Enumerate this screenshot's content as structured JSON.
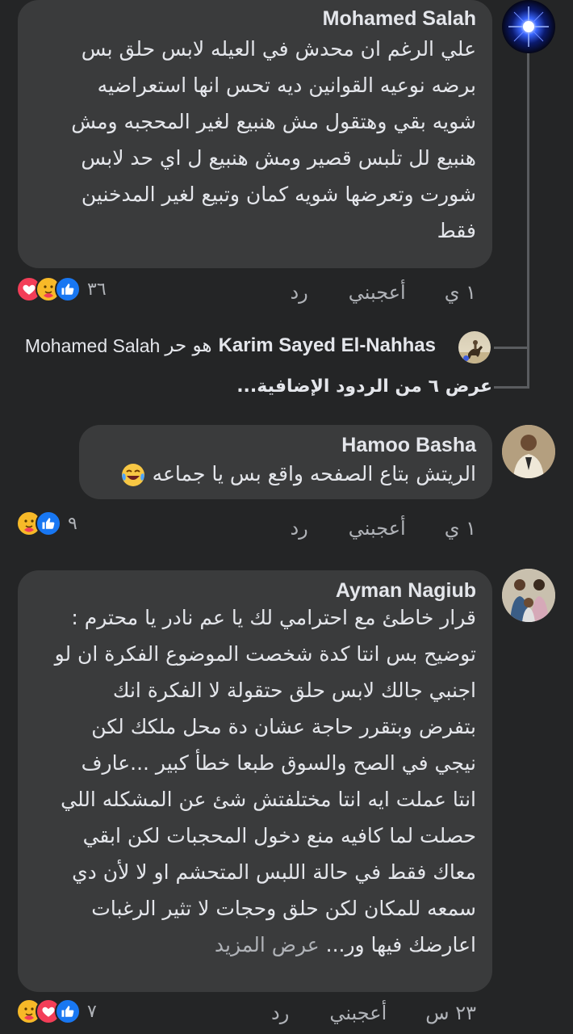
{
  "colors": {
    "background": "#242526",
    "bubble": "#3a3b3c",
    "text_primary": "#e4e6eb",
    "text_secondary": "#b0b3b8",
    "like_blue": "#1877f2",
    "love_red": "#f33e58",
    "care_yellow": "#f7b928"
  },
  "comments": [
    {
      "author": "Mohamed Salah",
      "lines": [
        "علي الرغم ان محدش في العيله لابس حلق بس",
        "برضه نوعيه القوانين ديه تحس انها استعراضيه",
        "شويه بقي وهتقول مش هنبيع لغير المحجبه ومش",
        "هنبيع لل تلبس قصير ومش هنبيع ل اي حد لابس",
        "شورت وتعرضها شويه كمان وتبيع لغير المدخنين",
        "فقط"
      ],
      "time": "١ ي",
      "like_label": "أعجبني",
      "reply_label": "رد",
      "reaction_count": "٣٦",
      "reactions": [
        "like-icon",
        "care-icon",
        "love-icon"
      ]
    },
    {
      "author": "Hamoo Basha",
      "lines": [
        "الريتش بتاع الصفحه واقع بس يا جماعه"
      ],
      "emoji": "laughing-tears-emoji",
      "time": "١ ي",
      "like_label": "أعجبني",
      "reply_label": "رد",
      "reaction_count": "٩",
      "reactions": [
        "like-icon",
        "care-icon"
      ]
    },
    {
      "author": "Ayman Nagiub",
      "lines": [
        "قرار خاطئ مع احترامي لك يا عم نادر يا محترم :",
        "توضيح بس انتا كدة شخصت الموضوع الفكرة ان لو",
        "اجنبي جالك لابس حلق حتقولة لا الفكرة انك",
        "بتفرض وبتقرر حاجة عشان دة محل ملكك لكن",
        "نيجي في الصح والسوق طبعا خطأ كبير ...عارف",
        "انتا عملت ايه انتا مختلفتش شئ عن المشكله اللي",
        "حصلت لما كافيه منع دخول المحجبات لكن ابقي",
        "معاك فقط في حالة اللبس المتحشم او لا لأن دي",
        "سمعه للمكان لكن حلق وحجات لا تثير الرغبات",
        "اعارضك فيها ور..."
      ],
      "see_more": "عرض المزيد",
      "time": "٢٣ س",
      "like_label": "أعجبني",
      "reply_label": "رد",
      "reaction_count": "٧",
      "reactions": [
        "like-icon",
        "love-icon",
        "care-icon"
      ]
    }
  ],
  "reply_preview": {
    "author": "Karim Sayed El-Nahhas",
    "text": "هو حر",
    "mention": "Mohamed Salah"
  },
  "view_more_replies": "عرض ٦ من الردود الإضافية..."
}
